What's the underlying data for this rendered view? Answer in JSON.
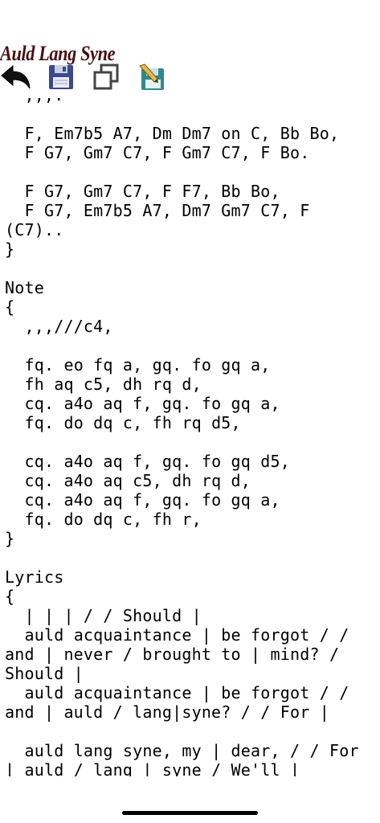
{
  "app": {
    "title": "Auld Lang Syne"
  },
  "toolbar": {
    "buttons": [
      {
        "icon": "back-arrow-icon"
      },
      {
        "icon": "save-icon"
      },
      {
        "icon": "copy-icon"
      },
      {
        "icon": "save-as-edit-icon"
      }
    ]
  },
  "editor": {
    "text": "  ,,,.\n\n  F, Em7b5 A7, Dm Dm7 on C, Bb Bo,\n  F G7, Gm7 C7, F Gm7 C7, F Bo.\n\n  F G7, Gm7 C7, F F7, Bb Bo,\n  F G7, Em7b5 A7, Dm7 Gm7 C7, F\n(C7)..\n}\n\nNote\n{\n  ,,,///c4,\n\n  fq. eo fq a, gq. fo gq a,\n  fh aq c5, dh rq d,\n  cq. a4o aq f, gq. fo gq a,\n  fq. do dq c, fh rq d5,\n\n  cq. a4o aq f, gq. fo gq d5,\n  cq. a4o aq c5, dh rq d,\n  cq. a4o aq f, gq. fo gq a,\n  fq. do dq c, fh r,\n}\n\nLyrics\n{\n  | | | / / Should |\n  auld acquaintance | be forgot / /\nand | never / brought to | mind? /\nShould |\n  auld acquaintance | be forgot / /\nand | auld / lang|syne? / / For |\n\n  auld lang syne, my | dear, / / For\n| auld / lang | syne / We'll |"
  }
}
